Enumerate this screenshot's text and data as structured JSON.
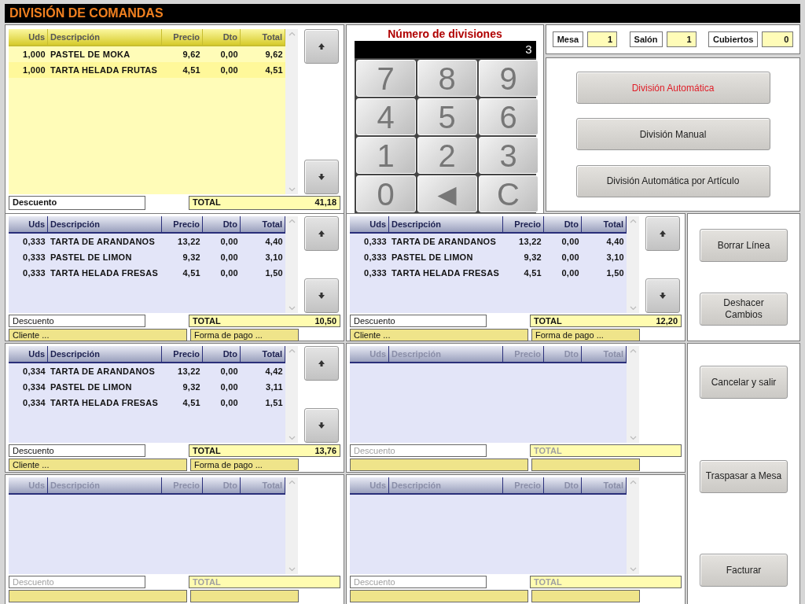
{
  "title": "DIVISIÓN DE COMANDAS",
  "main_order": {
    "columns": [
      "Uds",
      "Descripción",
      "Precio",
      "Dto",
      "Total"
    ],
    "rows": [
      {
        "cells": [
          "1,000",
          "PASTEL DE MOKA",
          "9,62",
          "0,00",
          "9,62"
        ],
        "selected": false
      },
      {
        "cells": [
          "1,000",
          "TARTA HELADA FRUTAS",
          "4,51",
          "0,00",
          "4,51"
        ],
        "selected": true
      }
    ],
    "discount_label": "Descuento",
    "total_label": "TOTAL",
    "total": "41,18"
  },
  "divisions": {
    "label": "Número de divisiones",
    "value": "3",
    "keys": [
      "7",
      "8",
      "9",
      "4",
      "5",
      "6",
      "1",
      "2",
      "3",
      "0",
      "◄",
      "C"
    ]
  },
  "info": [
    {
      "label": "Mesa",
      "value": "1"
    },
    {
      "label": "Salón",
      "value": "1"
    },
    {
      "label": "Cubiertos",
      "value": "0"
    }
  ],
  "division_buttons": [
    {
      "label": "División Automática",
      "selected": true
    },
    {
      "label": "División Manual",
      "selected": false
    },
    {
      "label": "División Automática por Artículo",
      "selected": false
    }
  ],
  "splits": [
    {
      "disabled": false,
      "columns": [
        "Uds",
        "Descripción",
        "Precio",
        "Dto",
        "Total"
      ],
      "rows": [
        [
          "0,333",
          "TARTA DE ARANDANOS",
          "13,22",
          "0,00",
          "4,40"
        ],
        [
          "0,333",
          "PASTEL DE LIMON",
          "9,32",
          "0,00",
          "3,10"
        ],
        [
          "0,333",
          "TARTA HELADA FRESAS",
          "4,51",
          "0,00",
          "1,50"
        ]
      ],
      "discount_label": "Descuento",
      "total_label": "TOTAL",
      "total": "10,50",
      "client_label": "Cliente ...",
      "payment_label": "Forma de pago ..."
    },
    {
      "disabled": false,
      "columns": [
        "Uds",
        "Descripción",
        "Precio",
        "Dto",
        "Total"
      ],
      "rows": [
        [
          "0,333",
          "TARTA DE ARANDANOS",
          "13,22",
          "0,00",
          "4,40"
        ],
        [
          "0,333",
          "PASTEL DE LIMON",
          "9,32",
          "0,00",
          "3,10"
        ],
        [
          "0,333",
          "TARTA HELADA FRESAS",
          "4,51",
          "0,00",
          "1,50"
        ]
      ],
      "discount_label": "Descuento",
      "total_label": "TOTAL",
      "total": "12,20",
      "client_label": "Cliente ...",
      "payment_label": "Forma de pago ..."
    },
    {
      "disabled": false,
      "columns": [
        "Uds",
        "Descripción",
        "Precio",
        "Dto",
        "Total"
      ],
      "rows": [
        [
          "0,334",
          "TARTA DE ARANDANOS",
          "13,22",
          "0,00",
          "4,42"
        ],
        [
          "0,334",
          "PASTEL DE LIMON",
          "9,32",
          "0,00",
          "3,11"
        ],
        [
          "0,334",
          "TARTA HELADA FRESAS",
          "4,51",
          "0,00",
          "1,51"
        ]
      ],
      "discount_label": "Descuento",
      "total_label": "TOTAL",
      "total": "13,76",
      "client_label": "Cliente ...",
      "payment_label": "Forma de pago ..."
    },
    {
      "disabled": true,
      "columns": [
        "Uds",
        "Descripción",
        "Precio",
        "Dto",
        "Total"
      ],
      "discount_label": "Descuento",
      "total_label": "TOTAL"
    },
    {
      "disabled": true,
      "columns": [
        "Uds",
        "Descripción",
        "Precio",
        "Dto",
        "Total"
      ],
      "discount_label": "Descuento",
      "total_label": "TOTAL"
    },
    {
      "disabled": true,
      "columns": [
        "Uds",
        "Descripción",
        "Precio",
        "Dto",
        "Total"
      ],
      "discount_label": "Descuento",
      "total_label": "TOTAL"
    }
  ],
  "actions_top": [
    "Borrar Línea",
    "Deshacer Cambios"
  ],
  "actions_bottom": [
    "Cancelar y salir",
    "Traspasar a Mesa",
    "Facturar"
  ]
}
